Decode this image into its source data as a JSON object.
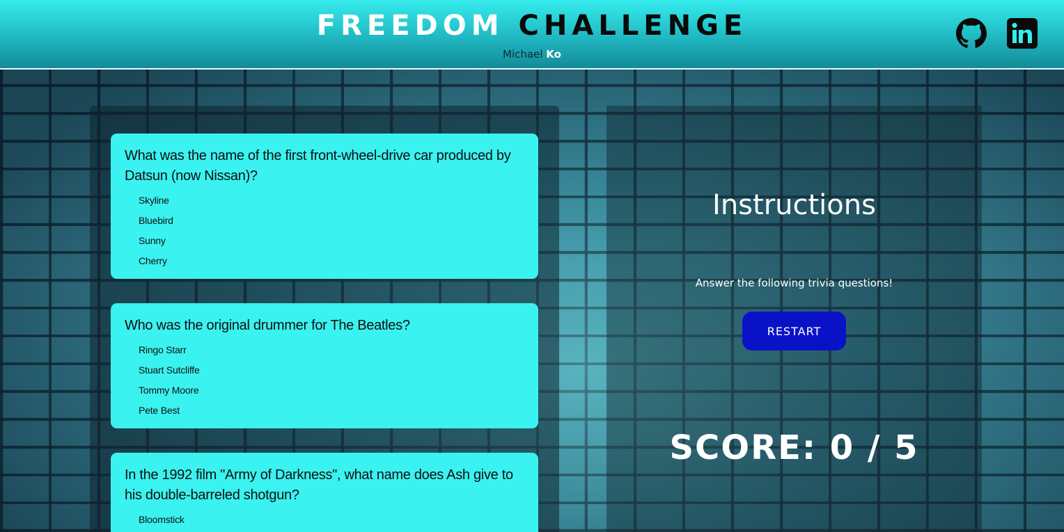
{
  "header": {
    "title_word1": "FREEDOM",
    "title_word2": "CHALLENGE",
    "author_first": "Michael",
    "author_last": "Ko",
    "icons": [
      "github-icon",
      "linkedin-icon"
    ]
  },
  "questions": [
    {
      "text": "What was the name of the first front-wheel-drive car produced by Datsun (now Nissan)?",
      "answers": [
        "Skyline",
        "Bluebird",
        "Sunny",
        "Cherry"
      ]
    },
    {
      "text": "Who was the original drummer for The Beatles?",
      "answers": [
        "Ringo Starr",
        "Stuart Sutcliffe",
        "Tommy Moore",
        "Pete Best"
      ]
    },
    {
      "text": "In the 1992 film \"Army of Darkness\", what name does Ash give to his double-barreled shotgun?",
      "answers": [
        "Bloomstick"
      ]
    }
  ],
  "sidebar": {
    "title": "Instructions",
    "text": "Answer the following trivia questions!",
    "restart_label": "RESTART",
    "score_label": "SCORE: 0 / 5"
  },
  "colors": {
    "header_top": "#36ecec",
    "card_bg": "#3af2f0",
    "restart_bg": "#0a12c8"
  }
}
